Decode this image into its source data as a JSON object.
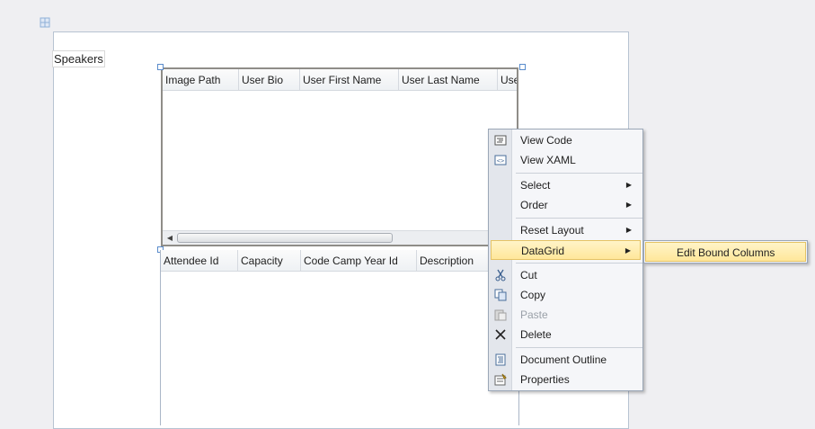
{
  "designer": {
    "label": "Speakers"
  },
  "grid1": {
    "columns": [
      "Image Path",
      "User Bio",
      "User First Name",
      "User Last Name",
      "User"
    ]
  },
  "grid2": {
    "columns": [
      "Attendee Id",
      "Capacity",
      "Code Camp Year Id",
      "Description"
    ]
  },
  "context_menu": {
    "items": [
      {
        "label": "View Code",
        "icon": "view-code-icon"
      },
      {
        "label": "View XAML",
        "icon": "view-xaml-icon"
      },
      {
        "label": "Select",
        "submenu": true
      },
      {
        "label": "Order",
        "submenu": true
      },
      {
        "label": "Reset Layout",
        "submenu": true
      },
      {
        "label": "DataGrid",
        "submenu": true,
        "highlighted": true
      },
      {
        "label": "Cut",
        "icon": "scissors-icon"
      },
      {
        "label": "Copy",
        "icon": "copy-icon"
      },
      {
        "label": "Paste",
        "icon": "paste-icon",
        "disabled": true
      },
      {
        "label": "Delete",
        "icon": "delete-x-icon"
      },
      {
        "label": "Document Outline",
        "icon": "document-outline-icon"
      },
      {
        "label": "Properties",
        "icon": "properties-icon"
      }
    ]
  },
  "datagrid_submenu": {
    "items": [
      {
        "label": "Edit Bound Columns",
        "highlighted": true
      }
    ]
  },
  "colors": {
    "highlight": "#ffe79a",
    "menu_bg": "#f5f6f9",
    "selection_handle": "#5a8ccc"
  }
}
